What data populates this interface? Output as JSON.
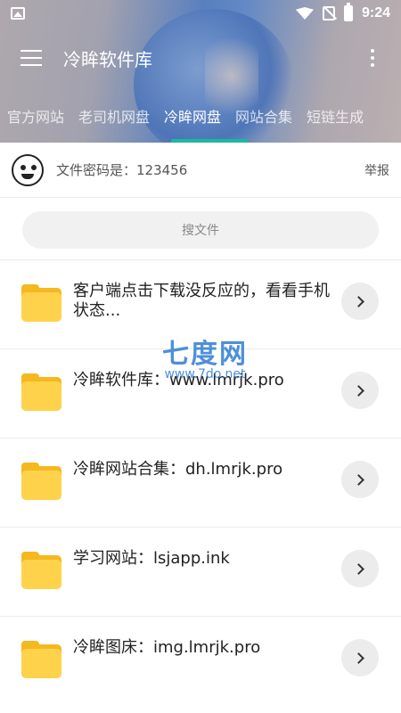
{
  "status_bar": {
    "time": "9:24"
  },
  "app_bar": {
    "title": "冷眸软件库"
  },
  "tabs": [
    "官方网站",
    "老司机网盘",
    "冷眸网盘",
    "网站合集",
    "短链生成"
  ],
  "active_tab_index": 2,
  "password_row": {
    "text": "文件密码是：123456",
    "report_label": "举报"
  },
  "search": {
    "label": "搜文件"
  },
  "files": [
    {
      "name": "客户端点击下载没反应的，看看手机状态..."
    },
    {
      "name": "冷眸软件库：www.lmrjk.pro"
    },
    {
      "name": "冷眸网站合集：dh.lmrjk.pro"
    },
    {
      "name": "学习网站：lsjapp.ink"
    },
    {
      "name": "冷眸图床：img.lmrjk.pro"
    }
  ],
  "watermark": {
    "title": "七度网",
    "url": "www.7do.net"
  },
  "colors": {
    "accent": "#1fb89c",
    "folder": "#ffd24c",
    "watermark": "#3b83d6"
  }
}
